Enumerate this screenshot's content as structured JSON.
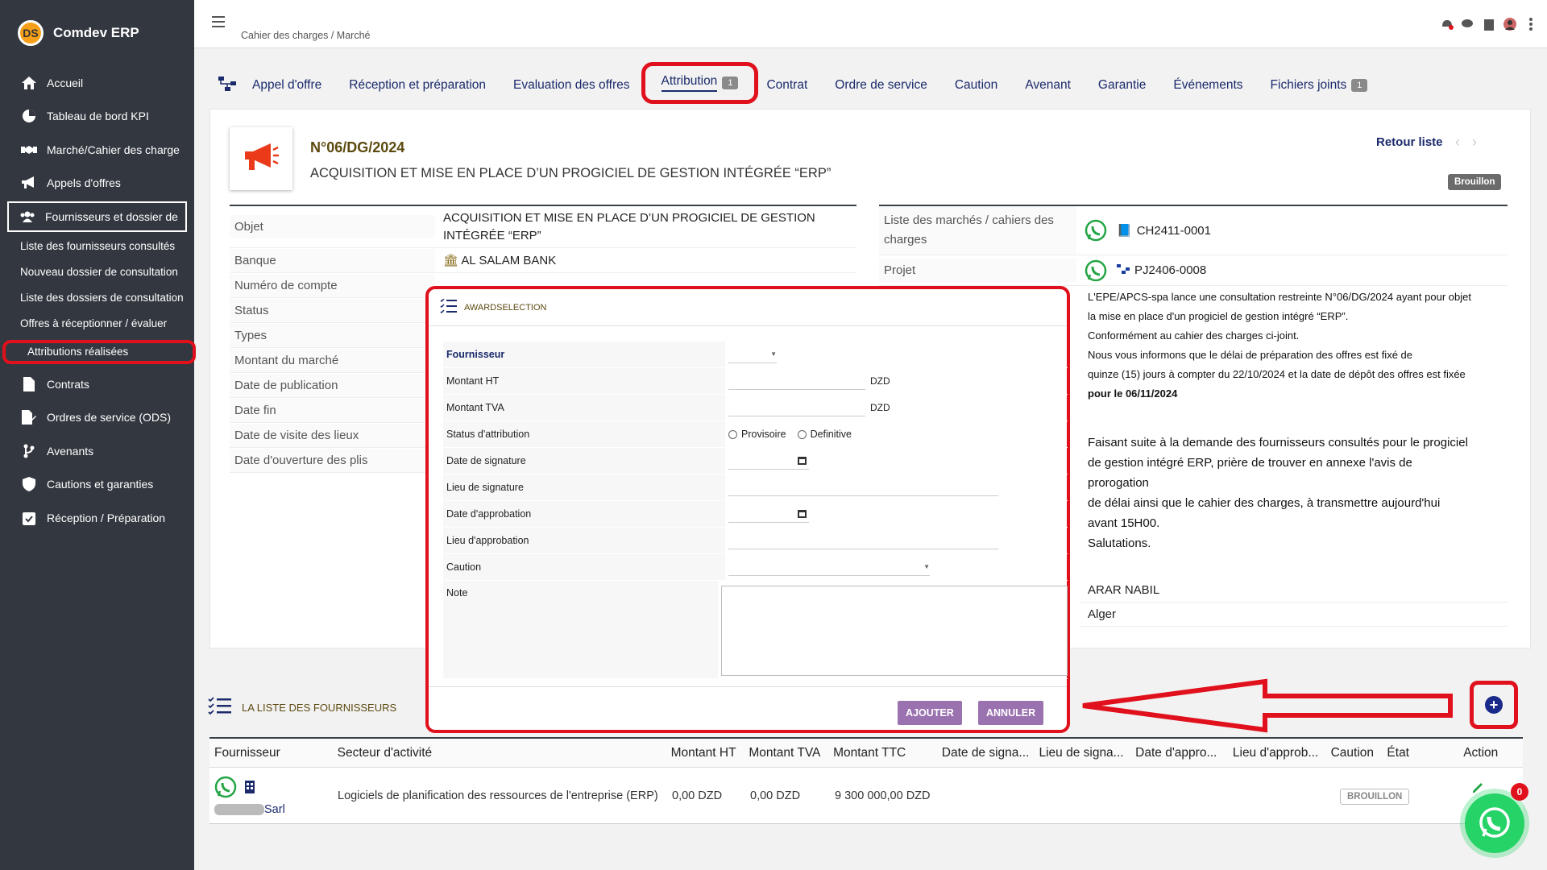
{
  "app": {
    "name": "Comdev ERP",
    "logo_text": "DS"
  },
  "sidebar": {
    "items": [
      {
        "label": "Accueil",
        "icon": "home-icon"
      },
      {
        "label": "Tableau de bord KPI",
        "icon": "pie-chart-icon"
      },
      {
        "label": "Marché/Cahier des charge",
        "icon": "handshake-icon"
      },
      {
        "label": "Appels d'offres",
        "icon": "megaphone-icon"
      },
      {
        "label": "Fournisseurs et dossier de",
        "icon": "users-icon"
      }
    ],
    "sub_items": [
      {
        "label": "Liste des fournisseurs consultés"
      },
      {
        "label": "Nouveau dossier de consultation"
      },
      {
        "label": "Liste des dossiers de consultation"
      },
      {
        "label": "Offres à réceptionner / évaluer"
      },
      {
        "label": "Attributions réalisées"
      }
    ],
    "items_after": [
      {
        "label": "Contrats",
        "icon": "document-icon"
      },
      {
        "label": "Ordres de service (ODS)",
        "icon": "edit-document-icon"
      },
      {
        "label": "Avenants",
        "icon": "branch-icon"
      },
      {
        "label": "Cautions et garanties",
        "icon": "shield-icon"
      },
      {
        "label": "Réception / Préparation",
        "icon": "clipboard-check-icon"
      }
    ]
  },
  "header": {
    "breadcrumb": "Cahier des charges / Marché"
  },
  "tabs": [
    {
      "label": "Appel d'offre"
    },
    {
      "label": "Réception et préparation"
    },
    {
      "label": "Evaluation des offres"
    },
    {
      "label": "Attribution",
      "badge": "1",
      "active": true
    },
    {
      "label": "Contrat"
    },
    {
      "label": "Ordre de service"
    },
    {
      "label": "Caution"
    },
    {
      "label": "Avenant"
    },
    {
      "label": "Garantie"
    },
    {
      "label": "Événements"
    },
    {
      "label": "Fichiers joints",
      "badge": "1"
    }
  ],
  "record": {
    "ref": "N°06/DG/2024",
    "title": "ACQUISITION ET MISE EN PLACE D’UN PROGICIEL DE GESTION INTÉGRÉE “ERP”",
    "back_label": "Retour liste",
    "status_badge": "Brouillon",
    "fields_left": [
      {
        "label": "Objet",
        "value": "ACQUISITION ET MISE EN PLACE D’UN PROGICIEL DE GESTION INTÉGRÉE “ERP”"
      },
      {
        "label": "Banque",
        "value": "AL SALAM BANK"
      },
      {
        "label": "Numéro de compte",
        "value": ""
      },
      {
        "label": "Status",
        "value": ""
      },
      {
        "label": "Types",
        "value": ""
      },
      {
        "label": "Montant du marché",
        "value": ""
      },
      {
        "label": "Date de publication",
        "value": ""
      },
      {
        "label": "Date fin",
        "value": ""
      },
      {
        "label": "Date de visite des lieux",
        "value": ""
      },
      {
        "label": "Date d'ouverture des plis",
        "value": ""
      }
    ],
    "fields_right": [
      {
        "label": "Liste des marchés / cahiers des charges",
        "value": "CH2411-0001"
      },
      {
        "label": "Projet",
        "value": "PJ2406-0008"
      }
    ],
    "description_lines": [
      "L'EPE/APCS-spa lance une consultation restreinte N°06/DG/2024 ayant pour objet",
      "la mise en place d'un progiciel de gestion intégré “ERP”.",
      "Conformément au cahier des charges ci-joint.",
      "Nous vous informons que le délai de préparation des offres est fixé de",
      "quinze (15) jours à compter du 22/10/2024 et la date de dépôt des offres est fixée",
      "pour le 06/11/2024"
    ],
    "message_lines": [
      "Faisant suite à la demande des fournisseurs consultés pour le progiciel",
      "de gestion intégré ERP, prière de trouver en annexe l'avis de",
      "prorogation",
      "de délai ainsi que le cahier des charges, à transmettre aujourd'hui",
      "avant 15H00.",
      "Salutations."
    ],
    "signatory": "ARAR NABIL",
    "city": "Alger"
  },
  "modal": {
    "title": "AWARDSELECTION",
    "fields": {
      "fournisseur": "Fournisseur",
      "montant_ht": "Montant HT",
      "montant_tva": "Montant TVA",
      "status": "Status d'attribution",
      "date_signature": "Date de signature",
      "lieu_signature": "Lieu de signature",
      "date_approbation": "Date d'approbation",
      "lieu_approbation": "Lieu d'approbation",
      "caution": "Caution",
      "note": "Note"
    },
    "currency": "DZD",
    "radio_options": [
      "Provisoire",
      "Definitive"
    ],
    "submit_label": "AJOUTER",
    "cancel_label": "ANNULER"
  },
  "suppliers": {
    "title": "LA LISTE DES FOURNISSEURS",
    "columns": [
      "Fournisseur",
      "Secteur d'activité",
      "Montant HT",
      "Montant TVA",
      "Montant TTC",
      "Date de signa...",
      "Lieu de signa...",
      "Date d'appro...",
      "Lieu d'approb...",
      "Caution",
      "État",
      "Action"
    ],
    "rows": [
      {
        "name_suffix": "Sarl",
        "sector": "Logiciels de planification des ressources de l'entreprise (ERP)",
        "ht": "0,00 DZD",
        "tva": "0,00 DZD",
        "ttc": "9 300 000,00 DZD",
        "state": "BROUILLON"
      }
    ]
  },
  "whatsapp_count": "0",
  "colors": {
    "sidebar": "#333840",
    "accent": "#1a2a6b",
    "highlight": "#e0111c",
    "button": "#9b72b0"
  }
}
